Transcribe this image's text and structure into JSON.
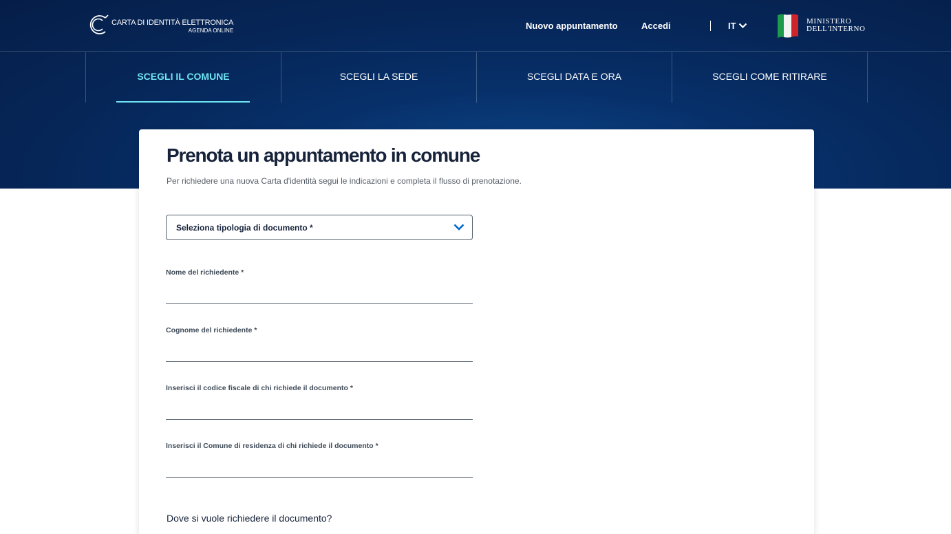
{
  "header": {
    "logo": {
      "line1": "CARTA DI IDENTITÀ ELETTRONICA",
      "line2": "AGENDA ONLINE",
      "icon": "cie-logo-icon"
    },
    "nav": {
      "new_appointment": "Nuovo appuntamento",
      "login": "Accedi",
      "language": "IT"
    },
    "ministry": {
      "line1": "MINISTERO",
      "line2": "DELL'INTERNO",
      "icon": "italian-flag-icon"
    }
  },
  "steps": [
    {
      "label": "SCEGLI IL COMUNE",
      "active": true
    },
    {
      "label": "SCEGLI LA SEDE",
      "active": false
    },
    {
      "label": "SCEGLI DATA E ORA",
      "active": false
    },
    {
      "label": "SCEGLI COME RITIRARE",
      "active": false
    }
  ],
  "form": {
    "title": "Prenota un appuntamento in comune",
    "subtitle": "Per richiedere una nuova Carta d'identità segui le indicazioni e completa il flusso di prenotazione.",
    "document_type": {
      "label": "Seleziona tipologia di documento *",
      "icon": "chevron-down-icon"
    },
    "fields": [
      {
        "label": "Nome del richiedente *",
        "value": ""
      },
      {
        "label": "Cognome del richiedente *",
        "value": ""
      },
      {
        "label": "Inserisci il codice fiscale di chi richiede il documento *",
        "value": ""
      },
      {
        "label": "Inserisci il Comune di residenza di chi richiede il documento *",
        "value": ""
      }
    ],
    "question": "Dove si vuole richiedere il documento?"
  },
  "colors": {
    "header_bg": "#062658",
    "active_step": "#6fe3f2",
    "accent_blue": "#0066cc",
    "text_dark": "#17233a"
  }
}
